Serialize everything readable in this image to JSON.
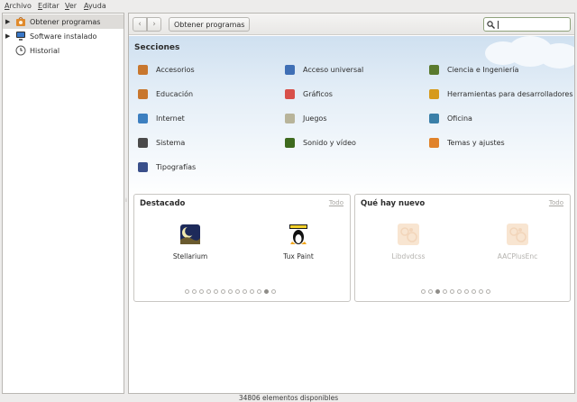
{
  "menubar": {
    "items": [
      "Archivo",
      "Editar",
      "Ver",
      "Ayuda"
    ]
  },
  "sidebar": {
    "items": [
      {
        "label": "Obtener programas",
        "icon": "software-center-icon",
        "selected": true,
        "expander": "▶"
      },
      {
        "label": "Software instalado",
        "icon": "computer-icon",
        "selected": false,
        "expander": "▶"
      },
      {
        "label": "Historial",
        "icon": "clock-icon",
        "selected": false,
        "expander": ""
      }
    ]
  },
  "toolbar": {
    "back": "‹",
    "forward": "›",
    "breadcrumb": "Obtener programas",
    "search_value": ""
  },
  "sections": {
    "title": "Secciones",
    "categories": [
      {
        "label": "Accesorios",
        "icon": "accessories-icon",
        "color": "#c8772e"
      },
      {
        "label": "Acceso universal",
        "icon": "universal-access-icon",
        "color": "#3f6fb5"
      },
      {
        "label": "Ciencia e Ingeniería",
        "icon": "science-icon",
        "color": "#5a7a2e"
      },
      {
        "label": "Educación",
        "icon": "education-icon",
        "color": "#c8772e"
      },
      {
        "label": "Gráficos",
        "icon": "graphics-icon",
        "color": "#d8504a"
      },
      {
        "label": "Herramientas para desarrolladores",
        "icon": "developer-tools-icon",
        "color": "#d69a1c"
      },
      {
        "label": "Internet",
        "icon": "internet-icon",
        "color": "#3c7fc0"
      },
      {
        "label": "Juegos",
        "icon": "games-icon",
        "color": "#b8b49a"
      },
      {
        "label": "Oficina",
        "icon": "office-icon",
        "color": "#3a7fa8"
      },
      {
        "label": "Sistema",
        "icon": "system-icon",
        "color": "#4a4a4a"
      },
      {
        "label": "Sonido y vídeo",
        "icon": "sound-video-icon",
        "color": "#3e6a1e"
      },
      {
        "label": "Temas y ajustes",
        "icon": "themes-icon",
        "color": "#e0822a"
      },
      {
        "label": "Tipografías",
        "icon": "fonts-icon",
        "color": "#3a4f8a"
      }
    ]
  },
  "featured": {
    "title": "Destacado",
    "all": "Todo",
    "apps": [
      {
        "name": "Stellarium",
        "icon": "stellarium-icon"
      },
      {
        "name": "Tux Paint",
        "icon": "tux-paint-icon"
      }
    ],
    "dot_count": 13,
    "active_dot": 11
  },
  "whats_new": {
    "title": "Qué hay nuevo",
    "all": "Todo",
    "apps": [
      {
        "name": "Libdvdcss",
        "icon": "package-icon"
      },
      {
        "name": "AACPlusEnc",
        "icon": "package-icon"
      }
    ],
    "dot_count": 10,
    "active_dot": 2
  },
  "status": {
    "text": "34806 elementos disponibles"
  }
}
